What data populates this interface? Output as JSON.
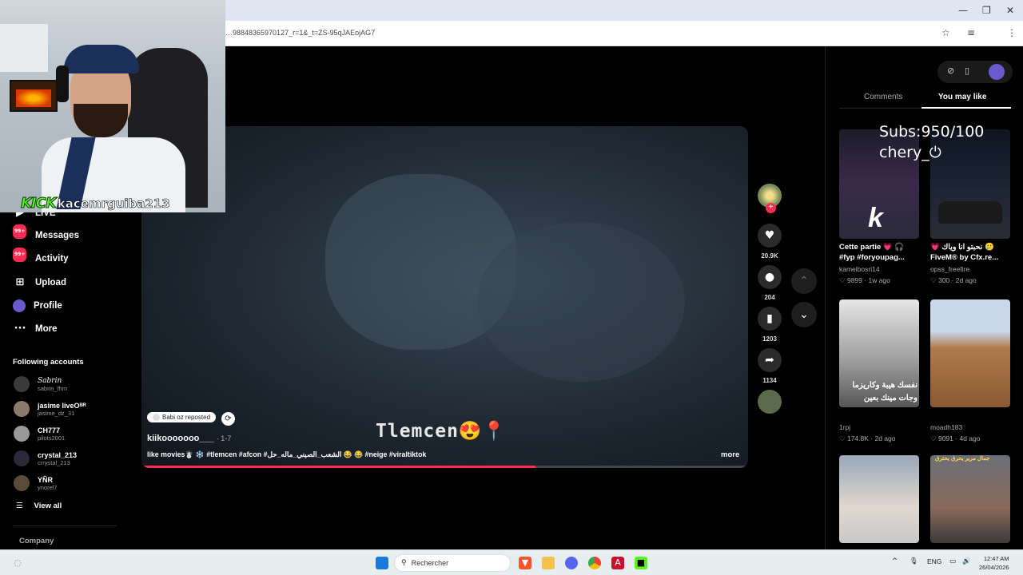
{
  "browser": {
    "url": "…98848365970127_r=1&_t=ZS-95qJAEojAG7",
    "win_min": "—",
    "win_restore": "❐",
    "win_close": "✕"
  },
  "sidebar": {
    "items": [
      {
        "label": "LIVE",
        "icon": "live-icon"
      },
      {
        "label": "Messages",
        "icon": "messages-icon",
        "badge": "99+"
      },
      {
        "label": "Activity",
        "icon": "activity-icon",
        "badge": "99+"
      },
      {
        "label": "Upload",
        "icon": "upload-icon"
      },
      {
        "label": "Profile",
        "icon": "profile-icon"
      },
      {
        "label": "More",
        "icon": "more-icon"
      }
    ],
    "following_heading": "Following accounts",
    "accounts": [
      {
        "name": "𝑆𝑎𝑏𝑟𝑖𝑛",
        "handle": "sabrin_fhm"
      },
      {
        "name": "jasime liveOᴮᴿ",
        "handle": "jasime_dz_31"
      },
      {
        "name": "CH777",
        "handle": "pilots2001"
      },
      {
        "name": "crystal_213",
        "handle": "crrystal_213"
      },
      {
        "name": "YÑR",
        "handle": "ynorel7"
      }
    ],
    "view_all": "View all",
    "company": "Company"
  },
  "video": {
    "overlay_title": "Tlemcen😍📍",
    "repost_label": "Babi ​oz reposted",
    "username": "kiikooooooo___",
    "date": "· 1-7",
    "caption": "like movies☃️ ❄️ #tlemcen #afcon #الشعب_الصيني_ماله_حل 😂 😂 #neige #viraltiktok",
    "more": "more",
    "progress": 0.65
  },
  "actions": {
    "likes": "20.9K",
    "comments": "204",
    "saves": "1203",
    "shares": "1134"
  },
  "right_panel": {
    "tabs": [
      "Comments",
      "You may like"
    ],
    "active_tab": "You may like",
    "tiles": [
      {
        "title": "Cette partie 💗 🎧 #fyp #foryoupag...",
        "author": "kamelbosri14",
        "likes": "♡ 9899",
        "age": "1w ago",
        "overlay": "k"
      },
      {
        "title": "💗 نحبتو انا وياك 🥲 FiveM® by Cfx.re...",
        "author": "opss_freefire",
        "likes": "♡ 300",
        "age": "2d ago",
        "overlay": "Subs:950/100 chery_⏻"
      },
      {
        "title": "",
        "author": "1rpj",
        "likes": "♡ 174.8K",
        "age": "2d ago",
        "overlay": "نفسك هيبة وكاريزما وجات مينك بعين"
      },
      {
        "title": "",
        "author": "moadh183",
        "likes": "♡ 9091",
        "age": "4d ago",
        "overlay": ""
      },
      {
        "title": "",
        "author": "",
        "likes": "",
        "age": "",
        "overlay": ""
      },
      {
        "title": "",
        "author": "",
        "likes": "",
        "age": "",
        "overlay": "جمال مرير يحرق يحترق"
      }
    ]
  },
  "stream_overlay": {
    "brand": "KICK",
    "channel": "kacemrguiba213"
  },
  "taskbar": {
    "search_placeholder": "Rechercher",
    "lang": "ENG",
    "time": "12:47 AM",
    "date": "26/04/2026"
  },
  "colors": {
    "accent": "#fe2c55",
    "kick_green": "#53fc18"
  }
}
